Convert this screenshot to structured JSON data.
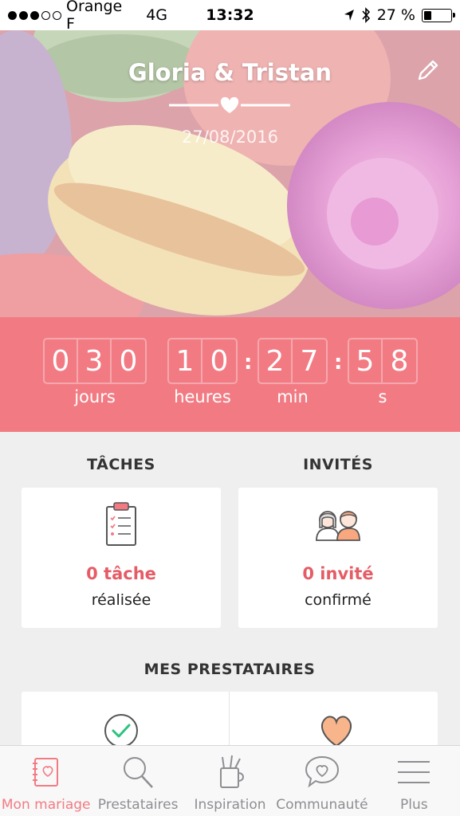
{
  "status_bar": {
    "carrier": "Orange F",
    "network": "4G",
    "time": "13:32",
    "battery": "27 %",
    "battery_level": 0.27,
    "signal_bars": 3,
    "signal_total": 5
  },
  "hero": {
    "title": "Gloria & Tristan",
    "date": "27/08/2016",
    "edit_icon": "pencil-icon"
  },
  "countdown": {
    "days": "030",
    "hours": "10",
    "minutes": "27",
    "seconds": "58",
    "labels": {
      "days": "jours",
      "hours": "heures",
      "minutes": "min",
      "seconds": "s"
    }
  },
  "sections": {
    "tasks": {
      "title": "TÂCHES",
      "count": "0 tâche",
      "sub": "réalisée",
      "icon": "clipboard-checklist-icon"
    },
    "guests": {
      "title": "INVITÉS",
      "count": "0 invité",
      "sub": "confirmé",
      "icon": "couple-icon"
    },
    "vendors": {
      "title": "MES PRESTATAIRES",
      "icons": [
        "check-circle-icon",
        "heart-icon"
      ]
    }
  },
  "tabbar": [
    {
      "label": "Mon mariage",
      "icon": "notebook-heart-icon",
      "active": true
    },
    {
      "label": "Prestataires",
      "icon": "search-icon",
      "active": false
    },
    {
      "label": "Inspiration",
      "icon": "tools-cup-icon",
      "active": false
    },
    {
      "label": "Communauté",
      "icon": "chat-heart-icon",
      "active": false
    },
    {
      "label": "Plus",
      "icon": "menu-icon",
      "active": false
    }
  ],
  "colors": {
    "accent": "#f27b83",
    "accent_text": "#e55c66",
    "background": "#efefef"
  }
}
